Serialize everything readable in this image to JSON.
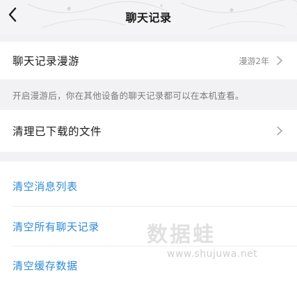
{
  "header": {
    "title": "聊天记录"
  },
  "settings": {
    "roaming": {
      "label": "聊天记录漫游",
      "value": "漫游2年"
    },
    "hint": "开启漫游后，你在其他设备的聊天记录都可以在本机查看。",
    "downloaded_files": {
      "label": "清理已下载的文件"
    }
  },
  "actions": [
    {
      "label": "清空消息列表"
    },
    {
      "label": "清空所有聊天记录"
    },
    {
      "label": "清空缓存数据"
    }
  ],
  "watermark": {
    "brand": "数据蛙",
    "url": "www.shujuwa.net"
  },
  "colors": {
    "accent": "#2d8ad6",
    "background": "#f2f2f4",
    "text": "#1a1a1a",
    "muted": "#8a8a8a"
  },
  "icons": {
    "back": "chevron-left-icon",
    "row_arrow": "chevron-right-icon"
  }
}
